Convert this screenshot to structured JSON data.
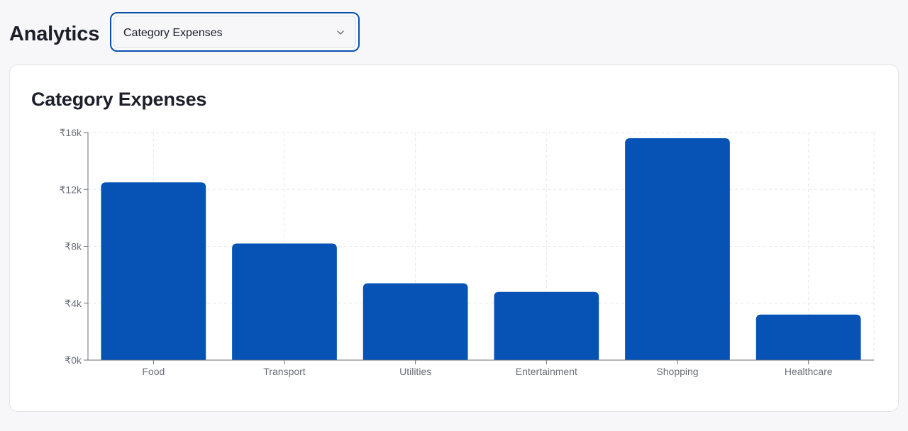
{
  "header": {
    "title": "Analytics",
    "select": {
      "value": "Category Expenses",
      "icon": "chevron-down-icon"
    }
  },
  "colors": {
    "bar": "#0652b5",
    "grid": "#e3e5e8",
    "axis": "#6b6f78",
    "select_border": "#0a4fb0"
  },
  "chart_data": {
    "type": "bar",
    "title": "Category Expenses",
    "xlabel": "",
    "ylabel": "",
    "categories": [
      "Food",
      "Transport",
      "Utilities",
      "Entertainment",
      "Shopping",
      "Healthcare"
    ],
    "values": [
      12500,
      8200,
      5400,
      4800,
      15600,
      3200
    ],
    "ylim": [
      0,
      16000
    ],
    "yticks": [
      0,
      4000,
      8000,
      12000,
      16000
    ],
    "ytick_labels": [
      "₹0k",
      "₹4k",
      "₹8k",
      "₹12k",
      "₹16k"
    ],
    "grid": true,
    "legend": "none"
  }
}
